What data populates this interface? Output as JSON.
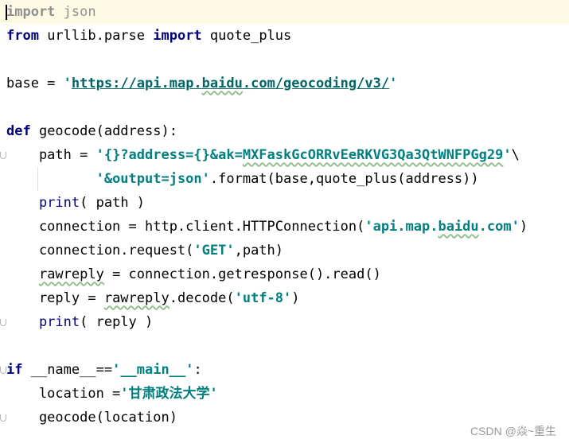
{
  "editor": {
    "lines": [
      {
        "id": "l1",
        "tokens": [
          {
            "t": "import",
            "c": "kw dim"
          },
          {
            "t": " json",
            "c": "dim"
          }
        ]
      },
      {
        "id": "l2",
        "tokens": [
          {
            "t": "from",
            "c": "kw"
          },
          {
            "t": " urllib.parse ",
            "c": ""
          },
          {
            "t": "import",
            "c": "kw"
          },
          {
            "t": " quote_plus",
            "c": ""
          }
        ]
      },
      {
        "id": "l3",
        "tokens": []
      },
      {
        "id": "l4",
        "tokens": [
          {
            "t": "base = ",
            "c": ""
          },
          {
            "t": "'",
            "c": "str"
          },
          {
            "t": "https://api.map.baidu.com/geocoding/v3/",
            "c": "str url"
          },
          {
            "t": "'",
            "c": "str"
          }
        ]
      },
      {
        "id": "l5",
        "tokens": []
      },
      {
        "id": "l6",
        "tokens": [
          {
            "t": "def",
            "c": "kw"
          },
          {
            "t": " geocode(address):",
            "c": ""
          }
        ]
      },
      {
        "id": "l7",
        "tokens": [
          {
            "t": "    path = ",
            "c": ""
          },
          {
            "t": "'{}?address={}&ak=MXFaskGcORRvEeRKVG3Qa3QtWNFPGg29'",
            "c": "str"
          },
          {
            "t": "\\",
            "c": ""
          }
        ]
      },
      {
        "id": "l8",
        "tokens": [
          {
            "t": "           ",
            "c": ""
          },
          {
            "t": "'&output=json'",
            "c": "str"
          },
          {
            "t": ".format(base,quote_plus(address))",
            "c": ""
          }
        ]
      },
      {
        "id": "l9",
        "tokens": [
          {
            "t": "    ",
            "c": ""
          },
          {
            "t": "print",
            "c": "builtin"
          },
          {
            "t": "( path )",
            "c": ""
          }
        ]
      },
      {
        "id": "l10",
        "tokens": [
          {
            "t": "    connection = http.client.HTTPConnection(",
            "c": ""
          },
          {
            "t": "'api.map.baidu.com'",
            "c": "str"
          },
          {
            "t": ")",
            "c": ""
          }
        ]
      },
      {
        "id": "l11",
        "tokens": [
          {
            "t": "    connection.request(",
            "c": ""
          },
          {
            "t": "'GET'",
            "c": "str"
          },
          {
            "t": ",path)",
            "c": ""
          }
        ]
      },
      {
        "id": "l12",
        "tokens": [
          {
            "t": "    rawreply = connection.getresponse().read()",
            "c": ""
          }
        ]
      },
      {
        "id": "l13",
        "tokens": [
          {
            "t": "    reply = rawreply.decode(",
            "c": ""
          },
          {
            "t": "'utf-8'",
            "c": "str"
          },
          {
            "t": ")",
            "c": ""
          }
        ]
      },
      {
        "id": "l14",
        "tokens": [
          {
            "t": "    ",
            "c": ""
          },
          {
            "t": "print",
            "c": "builtin"
          },
          {
            "t": "( reply )",
            "c": ""
          }
        ]
      },
      {
        "id": "l15",
        "tokens": []
      },
      {
        "id": "l16",
        "tokens": [
          {
            "t": "if",
            "c": "kw"
          },
          {
            "t": " __name__==",
            "c": ""
          },
          {
            "t": "'__main__'",
            "c": "str"
          },
          {
            "t": ":",
            "c": ""
          }
        ]
      },
      {
        "id": "l17",
        "tokens": [
          {
            "t": "    location =",
            "c": ""
          },
          {
            "t": "'甘肃政法大学'",
            "c": "str"
          }
        ]
      },
      {
        "id": "l18",
        "tokens": [
          {
            "t": "    geocode(location)",
            "c": ""
          }
        ]
      }
    ]
  },
  "watermark": "CSDN @焱~重生"
}
